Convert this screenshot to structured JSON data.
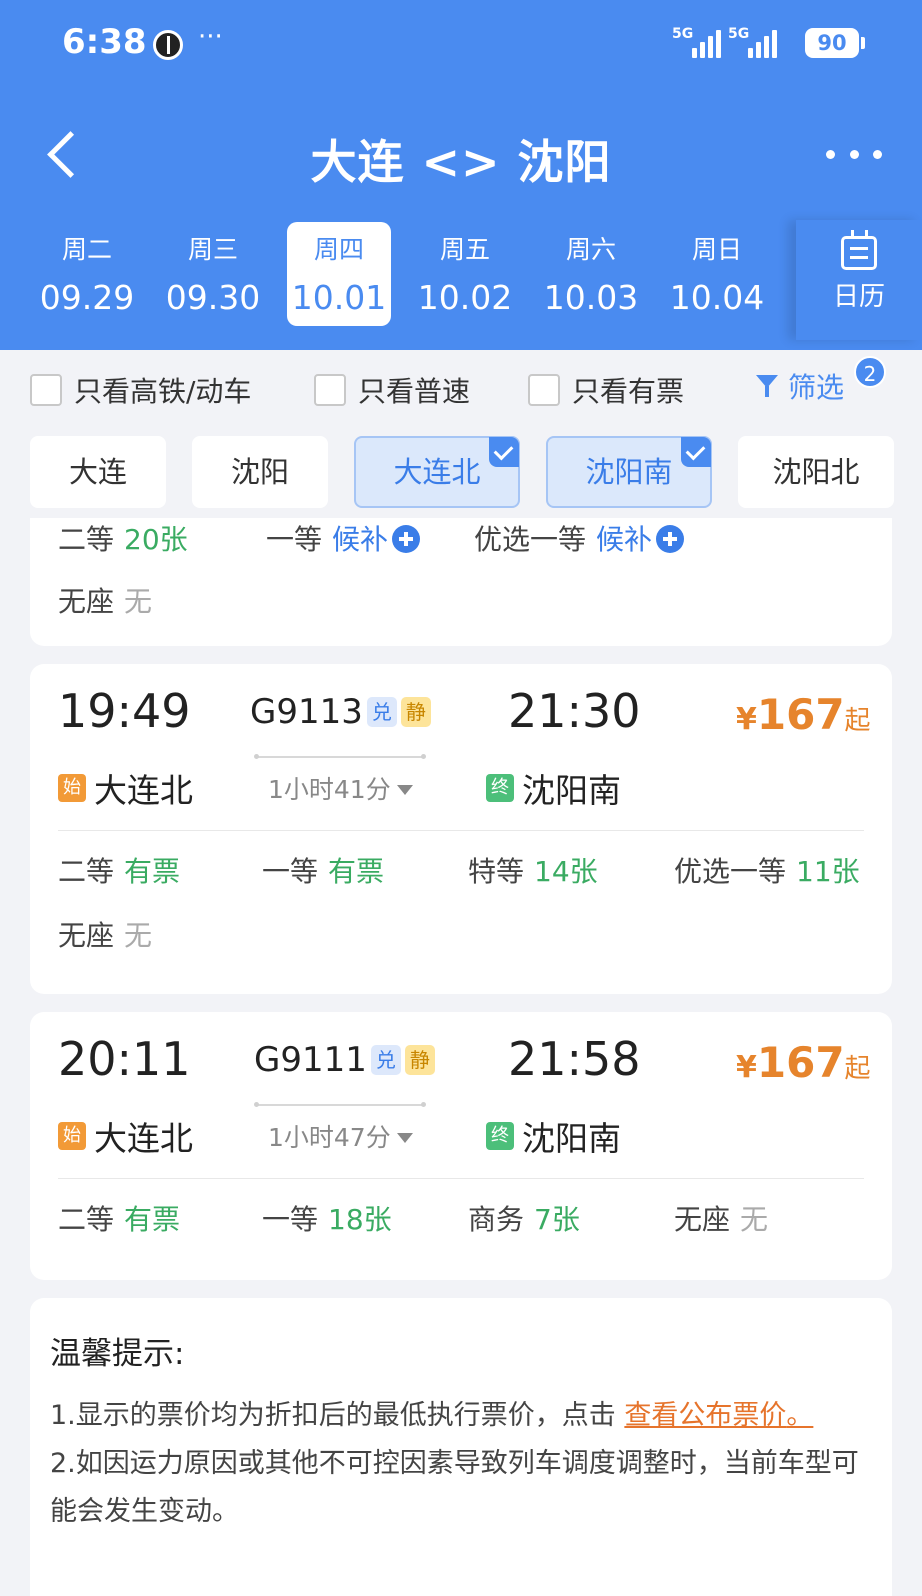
{
  "status_bar": {
    "time": "6:38",
    "dots": "···",
    "sim1": "5G",
    "sim2": "5G",
    "battery": "90"
  },
  "header": {
    "title": "大连 <> 沈阳"
  },
  "dates": [
    {
      "dow": "周二",
      "md": "09.29"
    },
    {
      "dow": "周三",
      "md": "09.30"
    },
    {
      "dow": "周四",
      "md": "10.01"
    },
    {
      "dow": "周五",
      "md": "10.02"
    },
    {
      "dow": "周六",
      "md": "10.03"
    },
    {
      "dow": "周日",
      "md": "10.04"
    }
  ],
  "calendar_label": "日历",
  "filters": {
    "gaotie": "只看高铁/动车",
    "pusu": "只看普速",
    "youpiao": "只看有票",
    "filter_label": "筛选",
    "filter_count": "2"
  },
  "stations": [
    "大连",
    "沈阳",
    "大连北",
    "沈阳南",
    "沈阳北"
  ],
  "partial_card": {
    "seats": [
      {
        "name": "二等",
        "value": "20张"
      },
      {
        "name": "一等",
        "value": "候补"
      },
      {
        "name": "优选一等",
        "value": "候补"
      },
      {
        "name": "无座",
        "value": "无"
      }
    ]
  },
  "trains": [
    {
      "depart_time": "19:49",
      "train_no": "G9113",
      "tag1": "兑",
      "tag2": "静",
      "arrive_time": "21:30",
      "duration": "1小时41分",
      "start_tag": "始",
      "from": "大连北",
      "end_tag": "终",
      "to": "沈阳南",
      "price_symbol": "¥",
      "price": "167",
      "price_suffix": "起",
      "seats": [
        {
          "name": "二等",
          "value": "有票"
        },
        {
          "name": "一等",
          "value": "有票"
        },
        {
          "name": "特等",
          "value": "14张"
        },
        {
          "name": "优选一等",
          "value": "11张"
        },
        {
          "name": "无座",
          "value": "无"
        }
      ]
    },
    {
      "depart_time": "20:11",
      "train_no": "G9111",
      "tag1": "兑",
      "tag2": "静",
      "arrive_time": "21:58",
      "duration": "1小时47分",
      "start_tag": "始",
      "from": "大连北",
      "end_tag": "终",
      "to": "沈阳南",
      "price_symbol": "¥",
      "price": "167",
      "price_suffix": "起",
      "seats": [
        {
          "name": "二等",
          "value": "有票"
        },
        {
          "name": "一等",
          "value": "18张"
        },
        {
          "name": "商务",
          "value": "7张"
        },
        {
          "name": "无座",
          "value": "无"
        }
      ]
    }
  ],
  "tips": {
    "title": "温馨提示:",
    "line1_prefix": "1.显示的票价均为折扣后的最低执行票价，点击",
    "line1_link": "查看公布票价",
    "line1_suffix": "。",
    "line2": "2.如因运力原因或其他不可控因素导致列车调度调整时，当前车型可能会发生变动。"
  },
  "colors": {
    "primary": "#4a8bf0",
    "available": "#3aab62",
    "price": "#e6842c",
    "waitlist": "#3a7de8"
  }
}
